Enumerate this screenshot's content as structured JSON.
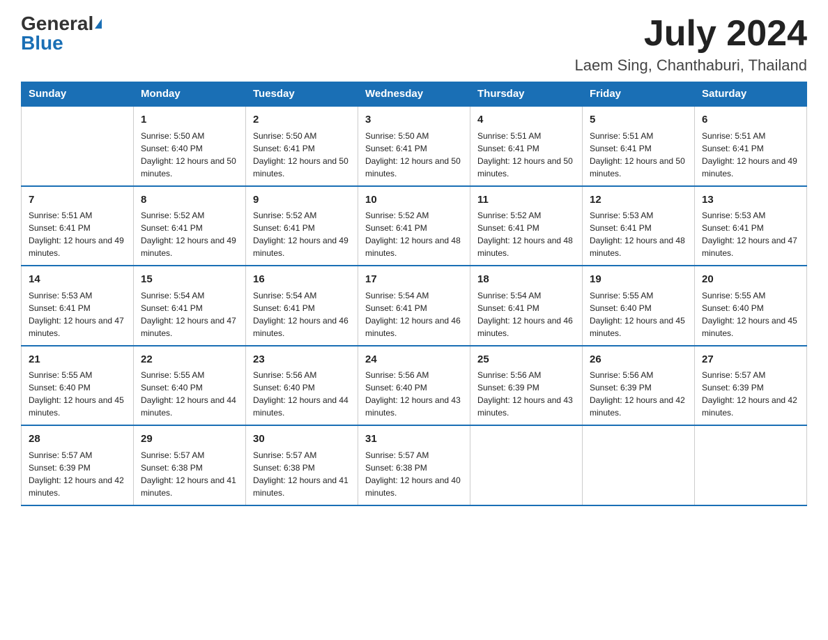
{
  "header": {
    "logo_general": "General",
    "logo_blue": "Blue",
    "month_title": "July 2024",
    "location": "Laem Sing, Chanthaburi, Thailand"
  },
  "weekdays": [
    "Sunday",
    "Monday",
    "Tuesday",
    "Wednesday",
    "Thursday",
    "Friday",
    "Saturday"
  ],
  "weeks": [
    [
      {
        "day": "",
        "sunrise": "",
        "sunset": "",
        "daylight": ""
      },
      {
        "day": "1",
        "sunrise": "Sunrise: 5:50 AM",
        "sunset": "Sunset: 6:40 PM",
        "daylight": "Daylight: 12 hours and 50 minutes."
      },
      {
        "day": "2",
        "sunrise": "Sunrise: 5:50 AM",
        "sunset": "Sunset: 6:41 PM",
        "daylight": "Daylight: 12 hours and 50 minutes."
      },
      {
        "day": "3",
        "sunrise": "Sunrise: 5:50 AM",
        "sunset": "Sunset: 6:41 PM",
        "daylight": "Daylight: 12 hours and 50 minutes."
      },
      {
        "day": "4",
        "sunrise": "Sunrise: 5:51 AM",
        "sunset": "Sunset: 6:41 PM",
        "daylight": "Daylight: 12 hours and 50 minutes."
      },
      {
        "day": "5",
        "sunrise": "Sunrise: 5:51 AM",
        "sunset": "Sunset: 6:41 PM",
        "daylight": "Daylight: 12 hours and 50 minutes."
      },
      {
        "day": "6",
        "sunrise": "Sunrise: 5:51 AM",
        "sunset": "Sunset: 6:41 PM",
        "daylight": "Daylight: 12 hours and 49 minutes."
      }
    ],
    [
      {
        "day": "7",
        "sunrise": "Sunrise: 5:51 AM",
        "sunset": "Sunset: 6:41 PM",
        "daylight": "Daylight: 12 hours and 49 minutes."
      },
      {
        "day": "8",
        "sunrise": "Sunrise: 5:52 AM",
        "sunset": "Sunset: 6:41 PM",
        "daylight": "Daylight: 12 hours and 49 minutes."
      },
      {
        "day": "9",
        "sunrise": "Sunrise: 5:52 AM",
        "sunset": "Sunset: 6:41 PM",
        "daylight": "Daylight: 12 hours and 49 minutes."
      },
      {
        "day": "10",
        "sunrise": "Sunrise: 5:52 AM",
        "sunset": "Sunset: 6:41 PM",
        "daylight": "Daylight: 12 hours and 48 minutes."
      },
      {
        "day": "11",
        "sunrise": "Sunrise: 5:52 AM",
        "sunset": "Sunset: 6:41 PM",
        "daylight": "Daylight: 12 hours and 48 minutes."
      },
      {
        "day": "12",
        "sunrise": "Sunrise: 5:53 AM",
        "sunset": "Sunset: 6:41 PM",
        "daylight": "Daylight: 12 hours and 48 minutes."
      },
      {
        "day": "13",
        "sunrise": "Sunrise: 5:53 AM",
        "sunset": "Sunset: 6:41 PM",
        "daylight": "Daylight: 12 hours and 47 minutes."
      }
    ],
    [
      {
        "day": "14",
        "sunrise": "Sunrise: 5:53 AM",
        "sunset": "Sunset: 6:41 PM",
        "daylight": "Daylight: 12 hours and 47 minutes."
      },
      {
        "day": "15",
        "sunrise": "Sunrise: 5:54 AM",
        "sunset": "Sunset: 6:41 PM",
        "daylight": "Daylight: 12 hours and 47 minutes."
      },
      {
        "day": "16",
        "sunrise": "Sunrise: 5:54 AM",
        "sunset": "Sunset: 6:41 PM",
        "daylight": "Daylight: 12 hours and 46 minutes."
      },
      {
        "day": "17",
        "sunrise": "Sunrise: 5:54 AM",
        "sunset": "Sunset: 6:41 PM",
        "daylight": "Daylight: 12 hours and 46 minutes."
      },
      {
        "day": "18",
        "sunrise": "Sunrise: 5:54 AM",
        "sunset": "Sunset: 6:41 PM",
        "daylight": "Daylight: 12 hours and 46 minutes."
      },
      {
        "day": "19",
        "sunrise": "Sunrise: 5:55 AM",
        "sunset": "Sunset: 6:40 PM",
        "daylight": "Daylight: 12 hours and 45 minutes."
      },
      {
        "day": "20",
        "sunrise": "Sunrise: 5:55 AM",
        "sunset": "Sunset: 6:40 PM",
        "daylight": "Daylight: 12 hours and 45 minutes."
      }
    ],
    [
      {
        "day": "21",
        "sunrise": "Sunrise: 5:55 AM",
        "sunset": "Sunset: 6:40 PM",
        "daylight": "Daylight: 12 hours and 45 minutes."
      },
      {
        "day": "22",
        "sunrise": "Sunrise: 5:55 AM",
        "sunset": "Sunset: 6:40 PM",
        "daylight": "Daylight: 12 hours and 44 minutes."
      },
      {
        "day": "23",
        "sunrise": "Sunrise: 5:56 AM",
        "sunset": "Sunset: 6:40 PM",
        "daylight": "Daylight: 12 hours and 44 minutes."
      },
      {
        "day": "24",
        "sunrise": "Sunrise: 5:56 AM",
        "sunset": "Sunset: 6:40 PM",
        "daylight": "Daylight: 12 hours and 43 minutes."
      },
      {
        "day": "25",
        "sunrise": "Sunrise: 5:56 AM",
        "sunset": "Sunset: 6:39 PM",
        "daylight": "Daylight: 12 hours and 43 minutes."
      },
      {
        "day": "26",
        "sunrise": "Sunrise: 5:56 AM",
        "sunset": "Sunset: 6:39 PM",
        "daylight": "Daylight: 12 hours and 42 minutes."
      },
      {
        "day": "27",
        "sunrise": "Sunrise: 5:57 AM",
        "sunset": "Sunset: 6:39 PM",
        "daylight": "Daylight: 12 hours and 42 minutes."
      }
    ],
    [
      {
        "day": "28",
        "sunrise": "Sunrise: 5:57 AM",
        "sunset": "Sunset: 6:39 PM",
        "daylight": "Daylight: 12 hours and 42 minutes."
      },
      {
        "day": "29",
        "sunrise": "Sunrise: 5:57 AM",
        "sunset": "Sunset: 6:38 PM",
        "daylight": "Daylight: 12 hours and 41 minutes."
      },
      {
        "day": "30",
        "sunrise": "Sunrise: 5:57 AM",
        "sunset": "Sunset: 6:38 PM",
        "daylight": "Daylight: 12 hours and 41 minutes."
      },
      {
        "day": "31",
        "sunrise": "Sunrise: 5:57 AM",
        "sunset": "Sunset: 6:38 PM",
        "daylight": "Daylight: 12 hours and 40 minutes."
      },
      {
        "day": "",
        "sunrise": "",
        "sunset": "",
        "daylight": ""
      },
      {
        "day": "",
        "sunrise": "",
        "sunset": "",
        "daylight": ""
      },
      {
        "day": "",
        "sunrise": "",
        "sunset": "",
        "daylight": ""
      }
    ]
  ]
}
